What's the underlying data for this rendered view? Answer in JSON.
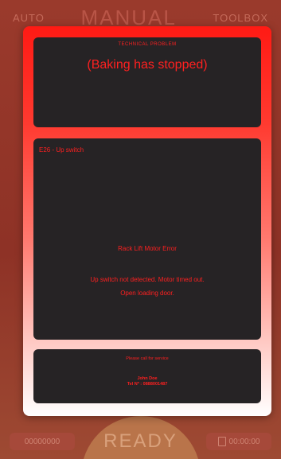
{
  "background": {
    "tabs": {
      "left": "AUTO",
      "center": "MANUAL",
      "right": "TOOLBOX"
    },
    "bottom": {
      "left_box": "00000000",
      "status": "READY",
      "right_box": "00:00:00"
    }
  },
  "modal": {
    "header": {
      "small_title": "TECHNICAL PROBLEM",
      "big_title": "(Baking has stopped)"
    },
    "error": {
      "code": "E26 - Up switch",
      "title": "Rack Lift Motor Error",
      "detail": "Up switch not detected.  Motor timed out.",
      "action": "Open loading door."
    },
    "service": {
      "prompt": "Please call for service",
      "name": "John Doe",
      "tel_label": "Tel Nº :",
      "tel_number": "0888001487"
    }
  },
  "colors": {
    "error_text": "#ff2020",
    "panel_bg": "#262325",
    "modal_gradient_top": "#ff1a14",
    "modal_gradient_bottom": "#ffffff"
  }
}
